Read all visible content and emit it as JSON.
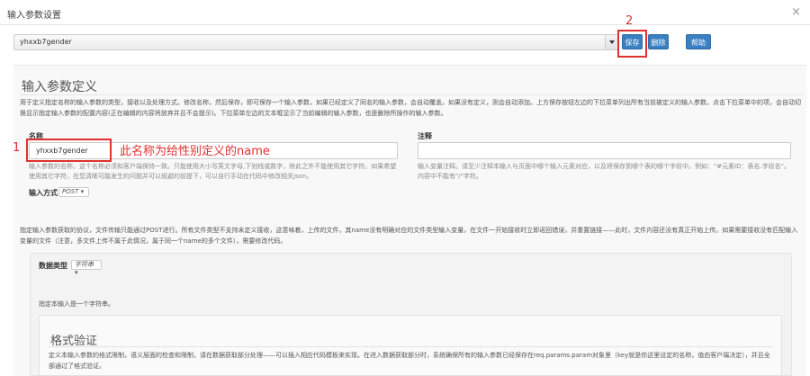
{
  "dialog": {
    "title": "输入参数设置",
    "close": "×"
  },
  "toolbar": {
    "selected_param": "yhxxb7gender",
    "save_label": "保存",
    "delete_label": "删除",
    "help_label": "帮助"
  },
  "annotations": {
    "num_2": "2",
    "num_1": "1",
    "note": "此名称为给性别定义的name"
  },
  "section": {
    "title": "输入参数定义",
    "description": "用于定义指定名称的输入参数的类型，接收以及处理方式。修改名称，然后保存，即可保存一个输入参数，如果已经定义了同名的输入参数，会自动覆盖。如果没有定义，则会自动添加。上方保存按钮左边的下拉菜单列出所有当前被定义的输入参数。点击下拉菜单中的项，会自动切换显示指定输入参数的配置内容(正在编辑的内容将放弃并且不会提示)。下拉菜单左边的文本框显示了当前编辑的输入参数，也是删除所操作的输入参数。"
  },
  "form": {
    "name_label": "名称",
    "name_value": "yhxxb7gender",
    "name_help": "输入参数的名称，这个名称必须和客户端保持一致。只能使用大小写英文字母,下划线或数字，除此之外不能使用其它字符。如果希望使用其它字符，在您清晰可能发生的问题并可以规避的前提下，可以自行手动在代码中修改相关json。",
    "comment_label": "注释",
    "comment_help": "输入变量注释。请至少注释本输入与页面中哪个输入元素对应，以及将保存到哪个表的哪个字段中。例如：\"#元素ID：表名.字段名\"。内容中不能有\"/\"字符。",
    "method_label": "输入方式",
    "method_value": "POST ▾"
  },
  "protocol": {
    "description": "指定输入参数获取的协议，文件传输只能通过POST进行。所有文件类型不支持未定义接收，这意味着，上传的文件，其name没有明确对应的文件类型输入变量，在文件一开始接收时立即返回错误，并重置链接——此时，文件内容还没有真正开始上传。如果需要接收没有匹配输入变量的文件（注意，多文件上传不属于此情况，属于同一个name的多个文件），需要修改代码。"
  },
  "datatype": {
    "label": "数据类型",
    "value": "字符串 ▾",
    "description": "指定本输入是一个字符串。"
  },
  "validation": {
    "title": "格式验证",
    "description": "定义本输入参数的格式限制，语义层面的检查和限制，请在数据获取部分处理——可以插入相应代码模板来实现。在进入数据获取部分时，系统确保所有的输入参数已经保存在req.params.param对象里（key就是你这里设定的名称，值由客户端决定），并且全部通过了格式验证。"
  }
}
